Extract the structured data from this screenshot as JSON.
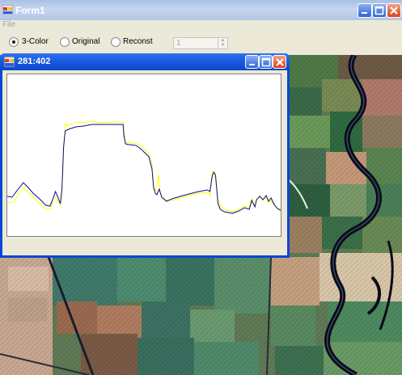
{
  "main_window": {
    "title": "Form1",
    "menu": {
      "file": "File"
    }
  },
  "toolbar": {
    "radios": [
      {
        "label": "3-Color",
        "checked": true
      },
      {
        "label": "Original",
        "checked": false
      },
      {
        "label": "Reconst",
        "checked": false
      }
    ],
    "spinner_value": "1"
  },
  "profile_window": {
    "title": "281:402"
  },
  "chart_data": {
    "type": "line",
    "title": "",
    "xlabel": "",
    "ylabel": "",
    "grid": false,
    "xlim": [
      0,
      340
    ],
    "ylim": [
      0,
      200
    ],
    "series": [
      {
        "color": "#0a0a8a",
        "points": [
          [
            0,
            49
          ],
          [
            6,
            48
          ],
          [
            12,
            56
          ],
          [
            20,
            66
          ],
          [
            26,
            60
          ],
          [
            32,
            53
          ],
          [
            40,
            46
          ],
          [
            48,
            38
          ],
          [
            53,
            37
          ],
          [
            56,
            44
          ],
          [
            60,
            55
          ],
          [
            63,
            48
          ],
          [
            66,
            40
          ],
          [
            68,
            58
          ],
          [
            70,
            110
          ],
          [
            72,
            130
          ],
          [
            76,
            132
          ],
          [
            85,
            135
          ],
          [
            95,
            136
          ],
          [
            105,
            138
          ],
          [
            115,
            138
          ],
          [
            130,
            138
          ],
          [
            140,
            138
          ],
          [
            144,
            138
          ],
          [
            145,
            125
          ],
          [
            147,
            114
          ],
          [
            152,
            113
          ],
          [
            160,
            112
          ],
          [
            166,
            108
          ],
          [
            170,
            104
          ],
          [
            176,
            98
          ],
          [
            180,
            83
          ],
          [
            182,
            60
          ],
          [
            184,
            53
          ],
          [
            186,
            51
          ],
          [
            189,
            58
          ],
          [
            192,
            48
          ],
          [
            198,
            43
          ],
          [
            205,
            46
          ],
          [
            215,
            49
          ],
          [
            226,
            52
          ],
          [
            238,
            55
          ],
          [
            249,
            57
          ],
          [
            252,
            55
          ],
          [
            255,
            75
          ],
          [
            257,
            79
          ],
          [
            259,
            75
          ],
          [
            262,
            40
          ],
          [
            265,
            33
          ],
          [
            270,
            30
          ],
          [
            280,
            28
          ],
          [
            288,
            31
          ],
          [
            295,
            35
          ],
          [
            301,
            33
          ],
          [
            304,
            44
          ],
          [
            308,
            36
          ],
          [
            310,
            45
          ],
          [
            314,
            49
          ],
          [
            318,
            45
          ],
          [
            322,
            50
          ],
          [
            325,
            43
          ],
          [
            328,
            47
          ],
          [
            332,
            39
          ],
          [
            336,
            34
          ],
          [
            340,
            32
          ]
        ]
      },
      {
        "color": "#ffff00",
        "points": [
          [
            0,
            41
          ],
          [
            8,
            42
          ],
          [
            14,
            52
          ],
          [
            20,
            60
          ],
          [
            26,
            54
          ],
          [
            32,
            48
          ],
          [
            40,
            41
          ],
          [
            48,
            33
          ],
          [
            54,
            34
          ],
          [
            58,
            50
          ],
          [
            63,
            44
          ],
          [
            66,
            38
          ],
          [
            68,
            54
          ],
          [
            70,
            104
          ],
          [
            72,
            139
          ],
          [
            76,
            136
          ],
          [
            85,
            141
          ],
          [
            95,
            140
          ],
          [
            105,
            142
          ],
          [
            115,
            140
          ],
          [
            130,
            141
          ],
          [
            144,
            141
          ],
          [
            145,
            130
          ],
          [
            147,
            116
          ],
          [
            152,
            116
          ],
          [
            162,
            114
          ],
          [
            170,
            109
          ],
          [
            176,
            102
          ],
          [
            180,
            88
          ],
          [
            182,
            60
          ],
          [
            184,
            56
          ],
          [
            186,
            65
          ],
          [
            188,
            76
          ],
          [
            190,
            53
          ],
          [
            196,
            45
          ],
          [
            205,
            44
          ],
          [
            215,
            47
          ],
          [
            226,
            50
          ],
          [
            238,
            53
          ],
          [
            249,
            54
          ],
          [
            252,
            50
          ],
          [
            255,
            80
          ],
          [
            258,
            76
          ],
          [
            262,
            45
          ],
          [
            265,
            38
          ],
          [
            270,
            33
          ],
          [
            280,
            30
          ],
          [
            288,
            33
          ],
          [
            295,
            37
          ],
          [
            301,
            36
          ],
          [
            304,
            46
          ],
          [
            308,
            38
          ],
          [
            311,
            46
          ],
          [
            314,
            50
          ],
          [
            318,
            44
          ],
          [
            322,
            48
          ],
          [
            325,
            41
          ],
          [
            328,
            44
          ],
          [
            332,
            38
          ],
          [
            336,
            34
          ],
          [
            340,
            30
          ]
        ]
      }
    ]
  }
}
